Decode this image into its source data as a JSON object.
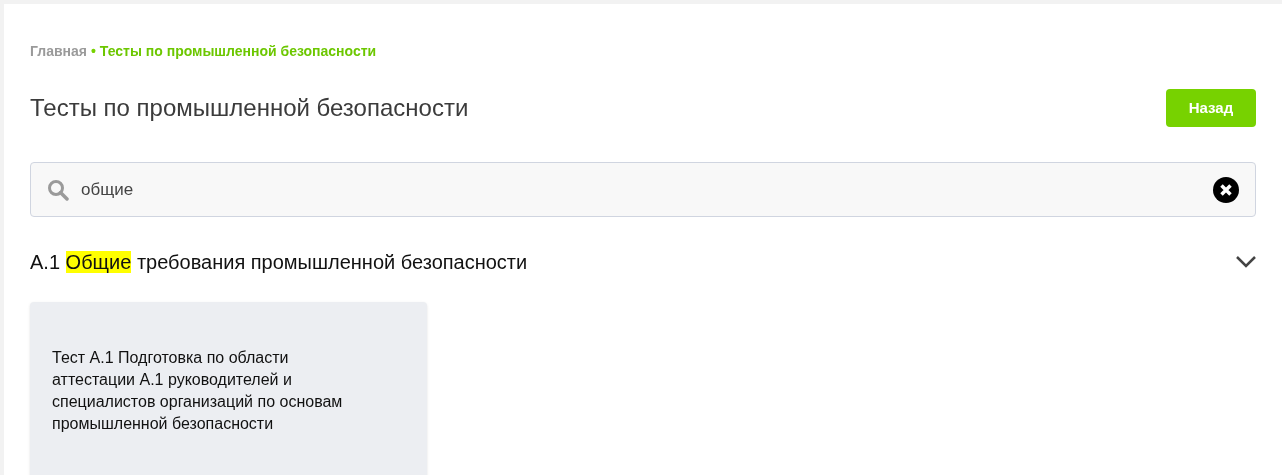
{
  "breadcrumbs": [
    {
      "label": "Главная",
      "current": false
    },
    {
      "label": "Тесты по промышленной безопасности",
      "current": true
    }
  ],
  "breadcrumb_separator": "•",
  "title": "Тесты по промышленной безопасности",
  "back_button": "Назад",
  "search": {
    "value": "общие"
  },
  "sections": [
    {
      "title_parts": [
        {
          "text": "А.1 ",
          "highlighted": false
        },
        {
          "text": "Общие",
          "highlighted": true
        },
        {
          "text": " требования промышленной безопасности",
          "highlighted": false
        }
      ],
      "expanded": true,
      "cards": [
        "Тест А.1 Подготовка по области аттестации А.1 руководителей и специалистов организаций по основам промышленной безопасности"
      ]
    }
  ]
}
